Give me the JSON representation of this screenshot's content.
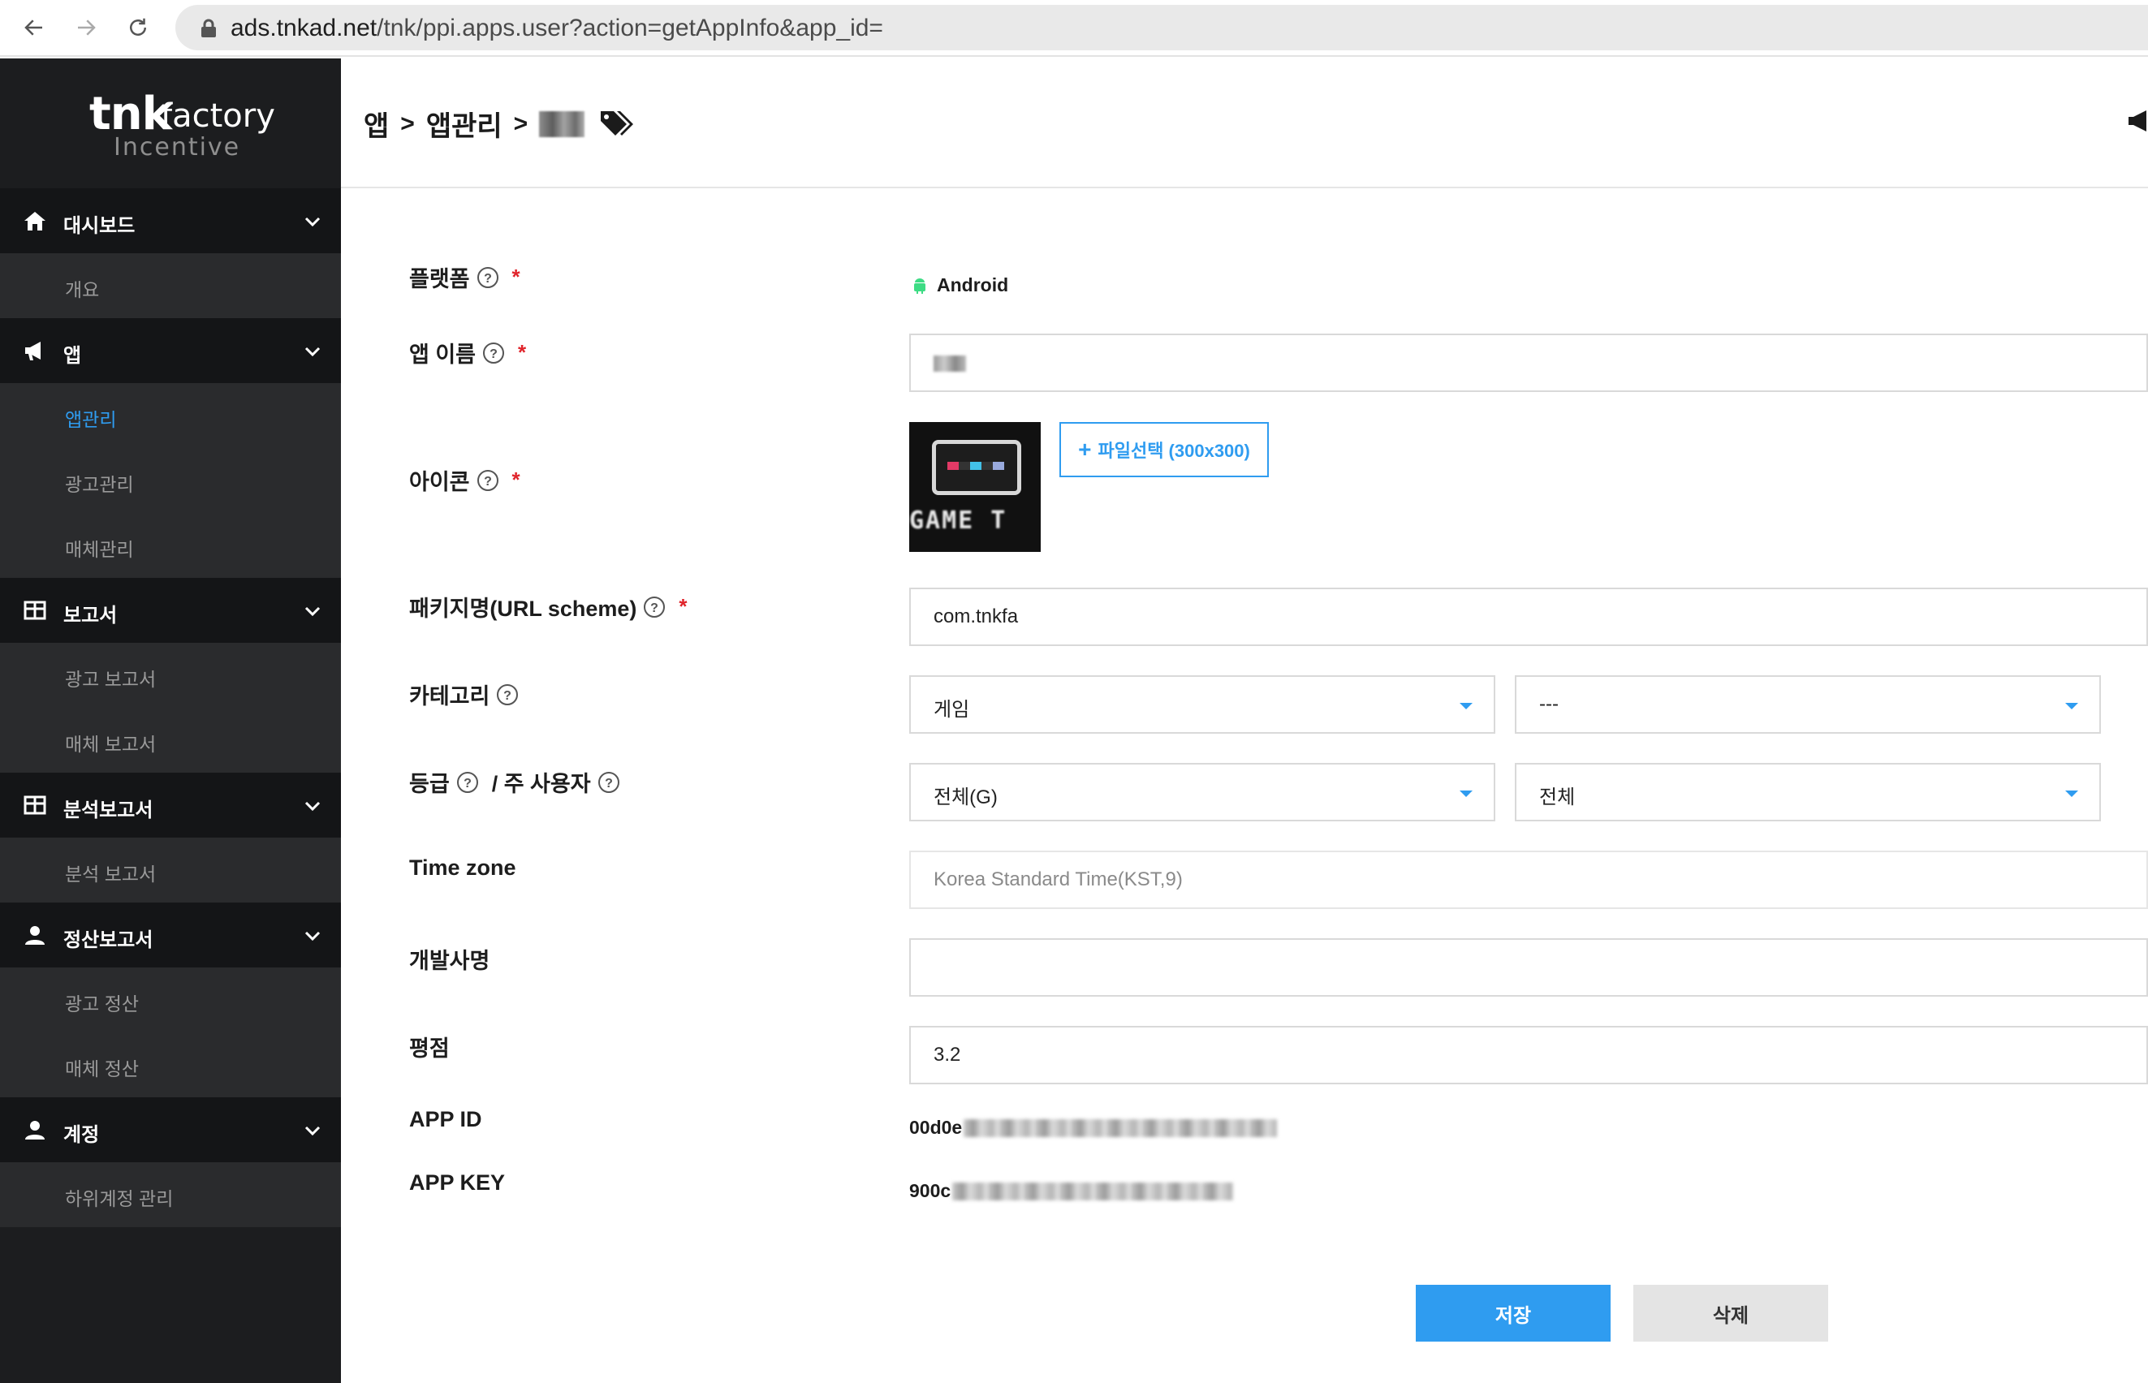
{
  "browser": {
    "url_host": "ads.tnkad.net",
    "url_path": "/tnk/ppi.apps.user?action=getAppInfo&app_id="
  },
  "brand": {
    "name": "tnk",
    "suffix": "factory",
    "sub": "Incentive"
  },
  "sidebar": {
    "groups": [
      {
        "label": "대시보드",
        "icon": "home-icon",
        "items": [
          {
            "label": "개요"
          }
        ]
      },
      {
        "label": "앱",
        "icon": "megaphone-icon",
        "items": [
          {
            "label": "앱관리",
            "active": true
          },
          {
            "label": "광고관리"
          },
          {
            "label": "매체관리"
          }
        ]
      },
      {
        "label": "보고서",
        "icon": "table-icon",
        "items": [
          {
            "label": "광고 보고서"
          },
          {
            "label": "매체 보고서"
          }
        ]
      },
      {
        "label": "분석보고서",
        "icon": "table-icon",
        "items": [
          {
            "label": "분석 보고서"
          }
        ]
      },
      {
        "label": "정산보고서",
        "icon": "user-icon",
        "items": [
          {
            "label": "광고 정산"
          },
          {
            "label": "매체 정산"
          }
        ]
      },
      {
        "label": "계정",
        "icon": "user-icon",
        "items": [
          {
            "label": "하위계정 관리"
          }
        ]
      }
    ]
  },
  "breadcrumb": {
    "items": [
      "앱",
      "앱관리"
    ],
    "separator": ">"
  },
  "form": {
    "platform": {
      "label": "플랫폼",
      "value": "Android",
      "required": "*"
    },
    "app_name": {
      "label": "앱 이름",
      "required": "*"
    },
    "icon": {
      "label": "아이콘",
      "required": "*",
      "image_text": "GAME T",
      "file_button": "파일선택 (300x300)"
    },
    "package": {
      "label": "패키지명(URL scheme)",
      "value": "com.tnkfa",
      "required": "*"
    },
    "category": {
      "label": "카테고리",
      "primary": "게임",
      "secondary": "---"
    },
    "grade": {
      "label": "등급",
      "label2": "/ 주 사용자",
      "grade_value": "전체(G)",
      "user_value": "전체"
    },
    "timezone": {
      "label": "Time zone",
      "value": "Korea Standard Time(KST,9)"
    },
    "developer": {
      "label": "개발사명",
      "value": ""
    },
    "rating": {
      "label": "평점",
      "value": "3.2"
    },
    "app_id": {
      "label": "APP ID",
      "value": "00d0e"
    },
    "app_key": {
      "label": "APP KEY",
      "value": "900c"
    }
  },
  "buttons": {
    "save": "저장",
    "delete": "삭제"
  },
  "colors": {
    "accent": "#2f9cf0",
    "sidebar_bg": "#1c1d1f",
    "required": "#e0242b"
  }
}
